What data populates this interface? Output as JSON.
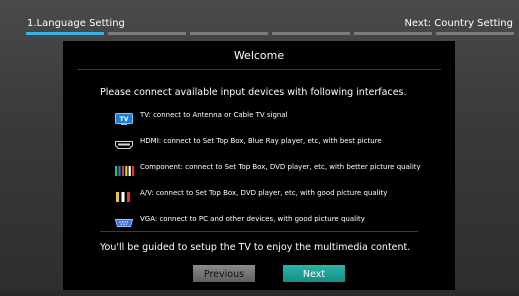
{
  "header": {
    "step_title": "1.Language Setting",
    "next_step": "Next: Country Setting",
    "progress": {
      "segments": 6,
      "active_index": 0
    }
  },
  "dialog": {
    "title": "Welcome",
    "intro": "Please connect available input devices with following interfaces.",
    "interfaces": [
      {
        "icon": "tv-icon",
        "label": "TV: connect to Antenna or Cable TV signal"
      },
      {
        "icon": "hdmi-icon",
        "label": "HDMI: connect to Set Top Box, Blue Ray player, etc, with best picture"
      },
      {
        "icon": "component-icon",
        "label": "Component: connect to Set Top Box, DVD player, etc, with better picture quality"
      },
      {
        "icon": "av-icon",
        "label": "A/V: connect to Set Top Box, DVD player, etc, with good picture quality"
      },
      {
        "icon": "vga-icon",
        "label": "VGA: connect to PC and other devices, with good picture quality"
      }
    ],
    "footer": "You'll be guided to setup the TV to enjoy the multimedia content.",
    "buttons": {
      "previous": "Previous",
      "next": "Next"
    }
  },
  "colors": {
    "accent": "#3ab4e8",
    "next_button": "#1fa396",
    "dialog_bg": "#000000"
  }
}
